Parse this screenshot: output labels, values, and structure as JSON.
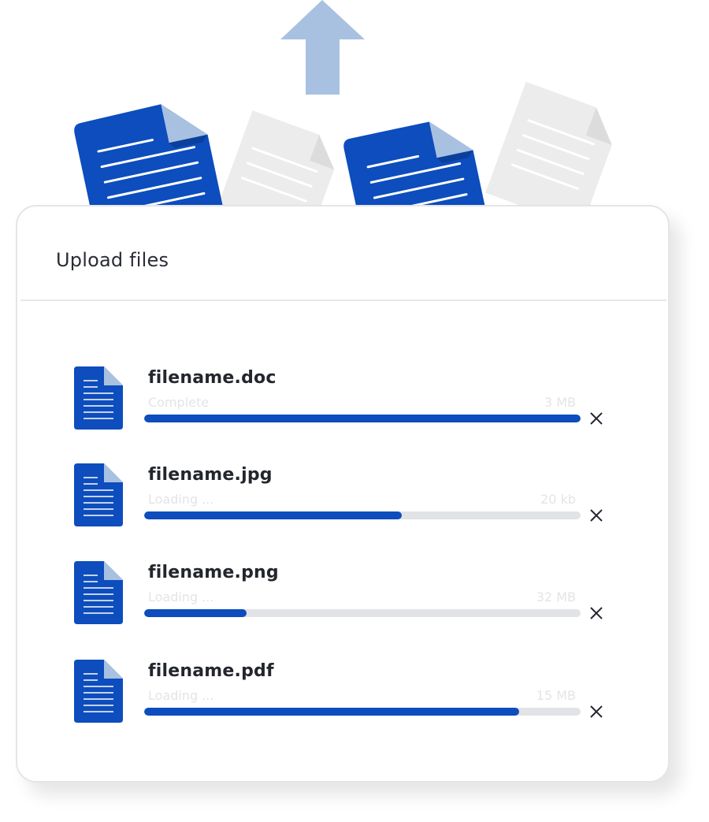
{
  "panel": {
    "title": "Upload files"
  },
  "colors": {
    "accent": "#0d4dbd",
    "track": "#e2e3e6",
    "arrow": "#a9c1e0",
    "ghost_doc": "#eeeeee"
  },
  "files": [
    {
      "name": "filename.doc",
      "status": "Complete",
      "size": "3 MB",
      "progress": 1.0,
      "icon": "document-icon",
      "remove_icon": "close-icon"
    },
    {
      "name": "filename.jpg",
      "status": "Loading ...",
      "size": "20 kb",
      "progress": 0.59,
      "icon": "document-icon",
      "remove_icon": "close-icon"
    },
    {
      "name": "filename.png",
      "status": "Loading ...",
      "size": "32 MB",
      "progress": 0.235,
      "icon": "document-icon",
      "remove_icon": "close-icon"
    },
    {
      "name": "filename.pdf",
      "status": "Loading ...",
      "size": "15 MB",
      "progress": 0.86,
      "icon": "document-icon",
      "remove_icon": "close-icon"
    }
  ]
}
